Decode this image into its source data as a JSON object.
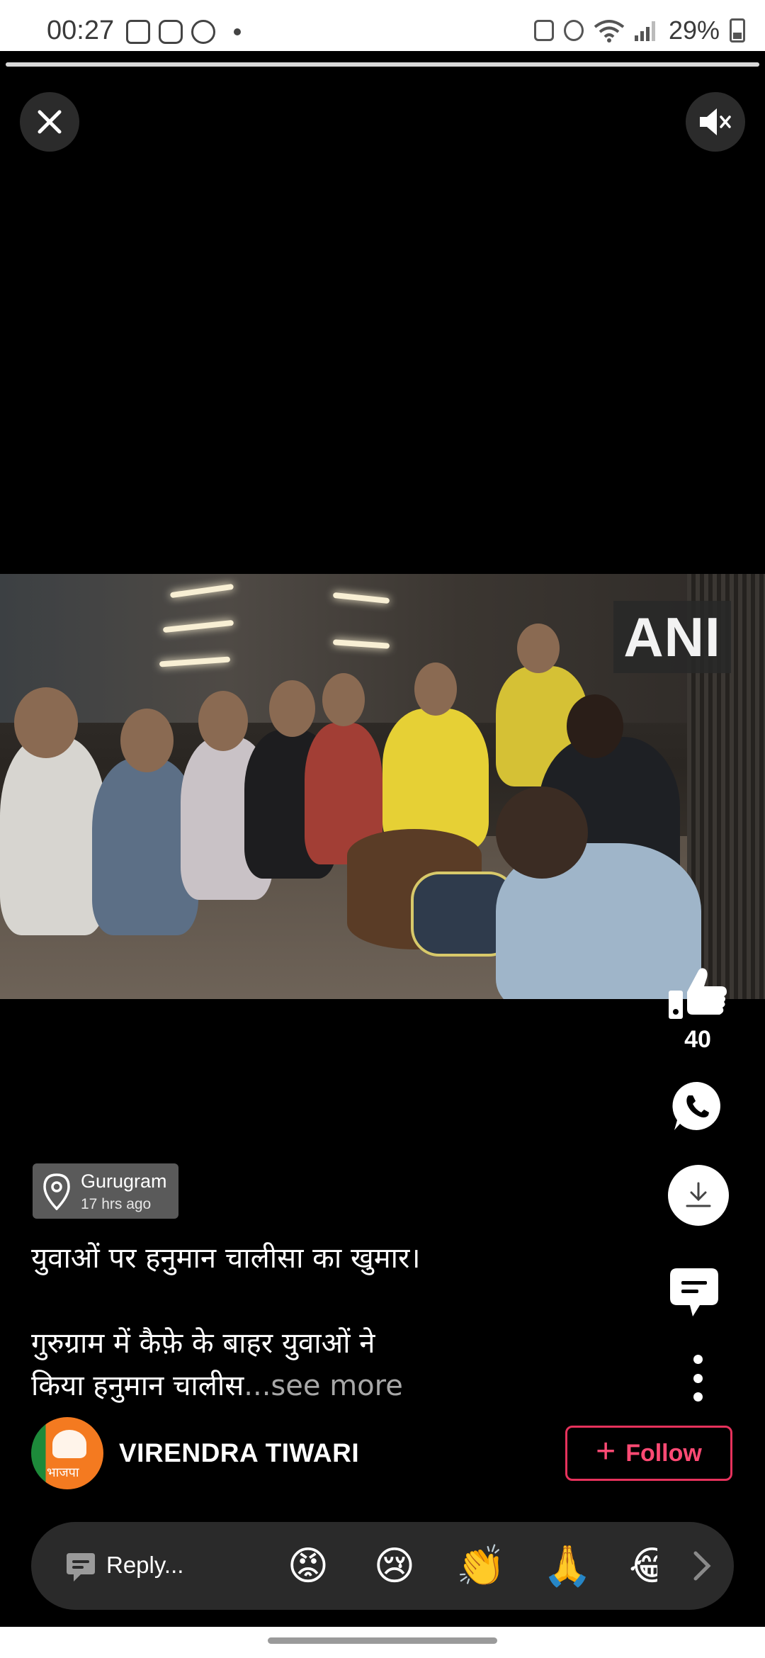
{
  "status_bar": {
    "time": "00:27",
    "battery": "29%",
    "notification_icons": [
      "gallery-icon",
      "instagram-icon",
      "whatsapp-icon"
    ]
  },
  "video": {
    "progress": 1.0,
    "watermark": "ANI"
  },
  "actions": {
    "like_count": "40"
  },
  "location": {
    "city": "Gurugram",
    "time_ago": "17 hrs ago"
  },
  "caption": {
    "line1": "युवाओं पर हनुमान चालीसा का खुमार।",
    "line2": "गुरुग्राम में कैफ़े के बाहर युवाओं ने",
    "line3": "किया हनुमान चालीस",
    "see_more": "...see more"
  },
  "author": {
    "name": "VIRENDRA TIWARI",
    "avatar_text": "भाजपा",
    "follow_label": "Follow"
  },
  "reply": {
    "placeholder": "Reply...",
    "emojis": [
      "😡",
      "😢",
      "👏",
      "🙏",
      "😂"
    ]
  },
  "colors": {
    "follow_accent": "#e6325c",
    "background": "#000000"
  }
}
